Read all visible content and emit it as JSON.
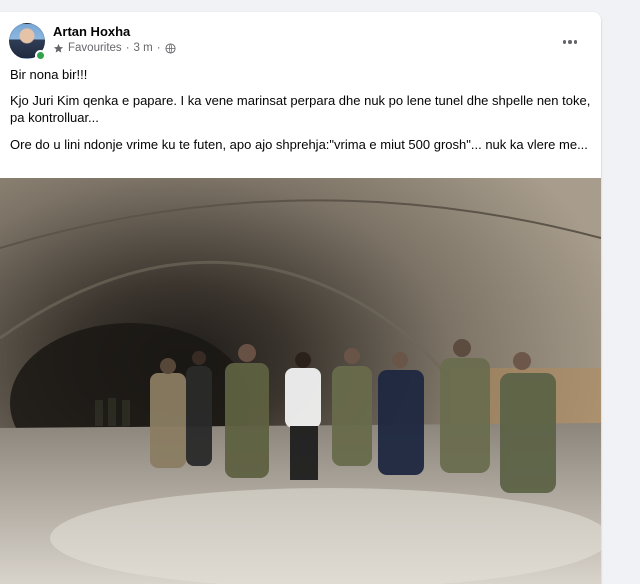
{
  "post": {
    "author": "Artan Hoxha",
    "audience": "Favourites",
    "separator": "·",
    "timestamp": "3 m",
    "separator2": "·",
    "paragraphs": [
      "Bir nona bir!!!",
      "Kjo Juri Kim qenka e papare. I ka vene marinsat perpara dhe nuk po lene tunel dhe shpelle nen toke, pa kontrolluar...",
      "Ore do u lini ndonje vrime ku te futen, apo ajo shprehja:\"vrima e miut 500 grosh\"... nuk ka vlere me..."
    ]
  },
  "icons": {
    "audience_icon": "star-icon",
    "privacy_icon": "globe-icon",
    "more_icon": "more-horizontal-icon"
  },
  "colors": {
    "page_bg": "#f0f2f5",
    "card_bg": "#ffffff",
    "text_primary": "#050505",
    "text_secondary": "#65676b",
    "online": "#31a24c"
  }
}
